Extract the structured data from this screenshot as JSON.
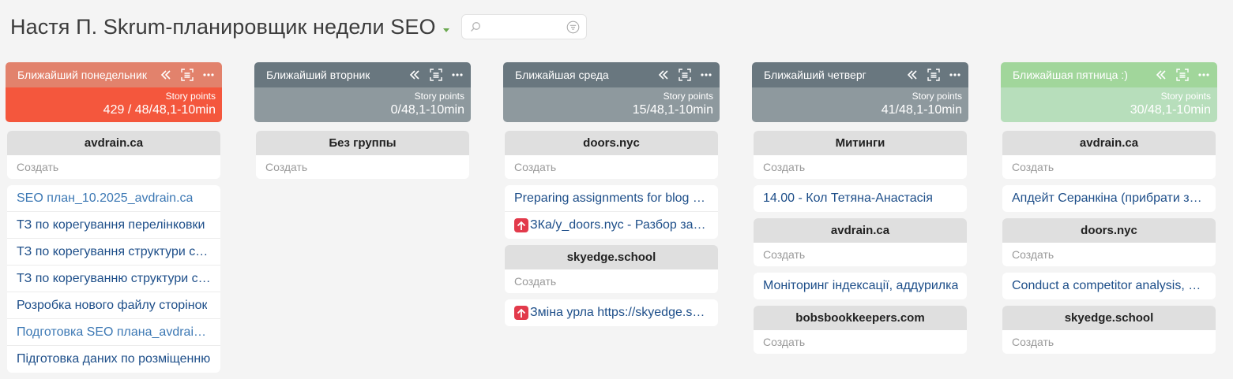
{
  "header": {
    "title": "Настя П. Skrum-планировщик недели SEO",
    "search_value": ""
  },
  "colors": {
    "monday_top": "#e2826c",
    "monday_bottom": "#f4573d",
    "gray_top": "#69777f",
    "gray_bottom": "#8e999e",
    "friday_top": "#a1d69b",
    "friday_bottom": "#b7debb",
    "priority": "#e23a4b",
    "title_caret": "#6aa84f"
  },
  "icons": [
    "search-icon",
    "filter-icon",
    "collapse-icon",
    "focus-icon",
    "more-icon",
    "priority-up-icon"
  ],
  "columns": [
    {
      "title": "Ближайший понедельник",
      "sp_label": "Story points",
      "sp_value": "429 / 48/48,1-10min",
      "groups": [
        {
          "name": "avdrain.ca",
          "create": "Создать",
          "tasks": [
            {
              "text": "SEO план_10.2025_avdrain.ca",
              "light": true
            },
            {
              "text": "ТЗ по корегування перелінковки"
            },
            {
              "text": "ТЗ по корегування структури сайту"
            },
            {
              "text": "ТЗ по корегуванню структури сайту"
            },
            {
              "text": "Розробка нового файлу сторінок"
            },
            {
              "text": "Подготовка SEO плана_avdrain.ca",
              "light": true
            },
            {
              "text": "Підготовка даних по розміщенню"
            }
          ]
        }
      ]
    },
    {
      "title": "Ближайший вторник",
      "sp_label": "Story points",
      "sp_value": "0/48,1-10min",
      "groups": [
        {
          "name": "Без группы",
          "create": "Создать",
          "tasks": []
        }
      ]
    },
    {
      "title": "Ближайшая среда",
      "sp_label": "Story points",
      "sp_value": "15/48,1-10min",
      "groups": [
        {
          "name": "doors.nyc",
          "create": "Создать",
          "tasks": [
            {
              "text": "Preparing assignments for blog posts"
            },
            {
              "text": "ЗКа/у_doors.nyc - Разбор задачи",
              "priority": true
            }
          ]
        },
        {
          "name": "skyedge.school",
          "create": "Создать",
          "tasks": [
            {
              "text": "Зміна урла https://skyedge.school",
              "priority": true
            }
          ]
        }
      ]
    },
    {
      "title": "Ближайший четверг",
      "sp_label": "Story points",
      "sp_value": "41/48,1-10min",
      "groups": [
        {
          "name": "Митинги",
          "create": "Создать",
          "tasks": [
            {
              "text": "14.00 - Кол Тетяна-Анастасія"
            }
          ]
        },
        {
          "name": "avdrain.ca",
          "create": "Создать",
          "tasks": [
            {
              "text": "Моніторинг індексації, аддурилка"
            }
          ]
        },
        {
          "name": "bobsbookkeepers.com",
          "create": "Создать",
          "tasks": []
        }
      ]
    },
    {
      "title": "Ближайшая пятница :)",
      "sp_label": "Story points",
      "sp_value": "30/48,1-10min",
      "groups": [
        {
          "name": "avdrain.ca",
          "create": "Создать",
          "tasks": [
            {
              "text": "Апдейт Серанкіна (прибрати зайве)"
            }
          ]
        },
        {
          "name": "doors.nyc",
          "create": "Создать",
          "tasks": [
            {
              "text": "Conduct a competitor analysis, pages"
            }
          ]
        },
        {
          "name": "skyedge.school",
          "create": "Создать",
          "tasks": []
        }
      ]
    }
  ]
}
